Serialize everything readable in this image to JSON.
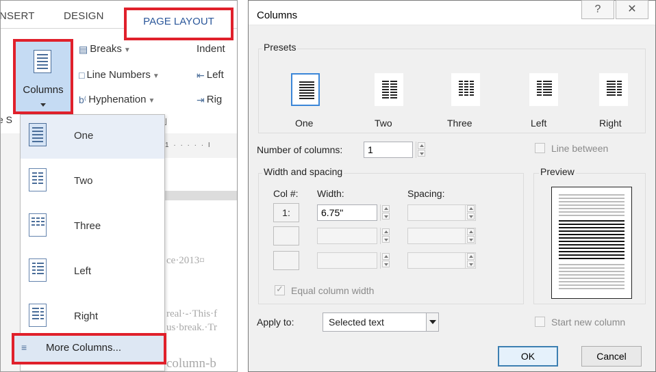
{
  "ribbon": {
    "tabs": [
      "NSERT",
      "DESIGN"
    ],
    "active_tab": "PAGE LAYOUT",
    "columns_button": "Columns",
    "breaks": "Breaks",
    "line_numbers": "Line Numbers",
    "hyphenation": "Hyphenation",
    "indent_title": "Indent",
    "indent_left": "Left",
    "indent_right": "Rig",
    "page_setup_fragment": "e S",
    "ruler_text": "1 · · · · · I"
  },
  "columns_menu": {
    "items": [
      {
        "label": "One",
        "icon": "one-column-icon"
      },
      {
        "label": "Two",
        "icon": "two-columns-icon"
      },
      {
        "label": "Three",
        "icon": "three-columns-icon"
      },
      {
        "label": "Left",
        "icon": "left-column-icon"
      },
      {
        "label": "Right",
        "icon": "right-column-icon"
      }
    ],
    "more": "More Columns..."
  },
  "document_fragments": {
    "line1": "ce·2013¤",
    "line2": "real·-·This·f",
    "line3": "us·break.·Tr",
    "line4": "column-b"
  },
  "dialog": {
    "title": "Columns",
    "help": "?",
    "close": "✕",
    "presets_title": "Presets",
    "presets": [
      "One",
      "Two",
      "Three",
      "Left",
      "Right"
    ],
    "number_of_columns_label": "Number of columns:",
    "number_of_columns_value": "1",
    "line_between": "Line between",
    "width_spacing_title": "Width and spacing",
    "col_header": "Col #:",
    "width_header": "Width:",
    "spacing_header": "Spacing:",
    "rows": [
      {
        "col": "1:",
        "width": "6.75\"",
        "spacing": ""
      },
      {
        "col": "",
        "width": "",
        "spacing": ""
      },
      {
        "col": "",
        "width": "",
        "spacing": ""
      }
    ],
    "equal_column_width": "Equal column width",
    "preview_title": "Preview",
    "apply_to_label": "Apply to:",
    "apply_to_value": "Selected text",
    "start_new_column": "Start new column",
    "ok": "OK",
    "cancel": "Cancel"
  },
  "colors": {
    "highlight_red": "#e0202b",
    "accent_blue": "#2b579a",
    "selected_fill": "#c5dbf3"
  }
}
